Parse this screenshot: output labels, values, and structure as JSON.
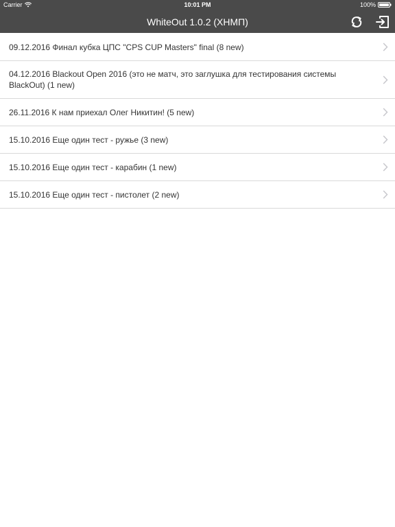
{
  "status_bar": {
    "carrier": "Carrier",
    "time": "10:01 PM",
    "battery": "100%"
  },
  "nav_bar": {
    "title": "WhiteOut 1.0.2 (ХНМП)",
    "refresh_icon": "refresh-icon",
    "logout_icon": "logout-icon"
  },
  "events": [
    {
      "label": "09.12.2016 Финал кубка ЦПС \"CPS CUP Masters\" final (8 new)"
    },
    {
      "label": "04.12.2016 Blackout Open 2016 (это не матч, это заглушка для тестирования системы BlackOut) (1 new)"
    },
    {
      "label": "26.11.2016 К нам приехал Олег Никитин! (5 new)"
    },
    {
      "label": "15.10.2016 Еще один тест - ружье (3 new)"
    },
    {
      "label": "15.10.2016 Еще один тест - карабин (1 new)"
    },
    {
      "label": "15.10.2016 Еще один тест - пистолет (2 new)"
    }
  ],
  "colors": {
    "header_bg": "#4a4a4a",
    "separator": "#d9d9d9",
    "text": "#333333",
    "chevron": "#c7c7cc"
  }
}
